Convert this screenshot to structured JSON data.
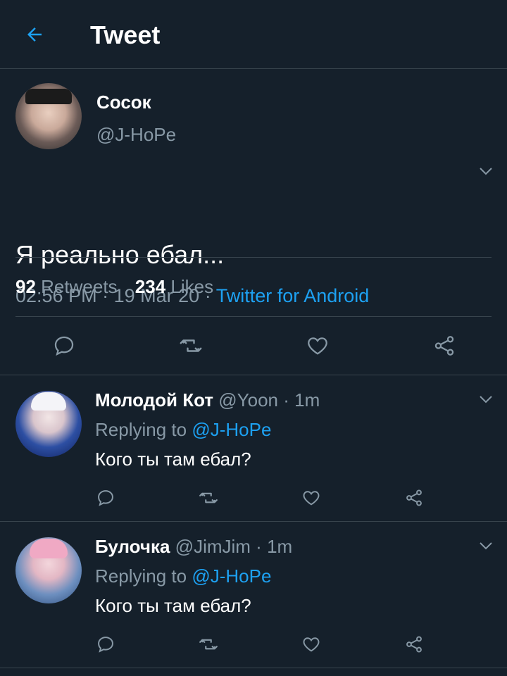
{
  "header": {
    "back_icon": "arrow-left-icon",
    "title": "Tweet"
  },
  "colors": {
    "background": "#15202b",
    "divider": "#38444d",
    "secondary_text": "#8899a6",
    "accent": "#1da1f2"
  },
  "main_tweet": {
    "name": "Сосок",
    "handle": "@J-HoPe",
    "text": "Я реально ебал...",
    "time": "02:56 PM",
    "date": "19 Mar 20",
    "separator": "·",
    "source": "Twitter for Android",
    "retweets_count": "92",
    "retweets_label": "Retweets",
    "likes_count": "234",
    "likes_label": "Likes"
  },
  "replies": [
    {
      "name": "Молодой Кот",
      "handle": "@Yoon",
      "time": "1m",
      "replying_label": "Replying to",
      "replying_to": "@J-HoPe",
      "text": "Кого ты там ебал?"
    },
    {
      "name": "Булочка",
      "handle": "@JimJim",
      "time": "1m",
      "replying_label": "Replying to",
      "replying_to": "@J-HoPe",
      "text": "Кого ты там ебал?"
    }
  ],
  "actions": [
    "reply-icon",
    "retweet-icon",
    "like-icon",
    "share-icon"
  ]
}
